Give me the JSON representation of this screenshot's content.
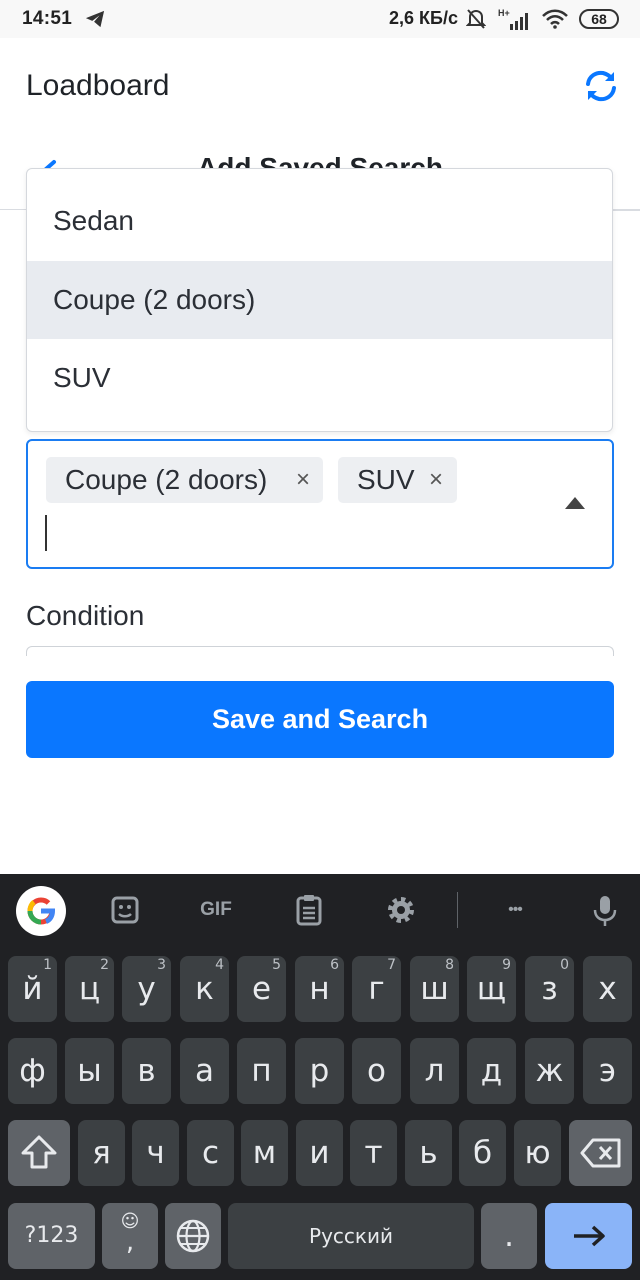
{
  "status_bar": {
    "time": "14:51",
    "network_speed": "2,6 КБ/с",
    "battery": "68",
    "signal_label": "H+"
  },
  "app": {
    "title": "Loadboard",
    "subtitle": "Add Saved Search"
  },
  "dropdown": {
    "options": [
      {
        "label": "Sedan",
        "highlighted": false
      },
      {
        "label": "Coupe (2 doors)",
        "highlighted": true
      },
      {
        "label": "SUV",
        "highlighted": false
      }
    ]
  },
  "multi_select": {
    "selected": [
      "Coupe (2 doors)",
      "SUV"
    ],
    "remove_symbol": "×"
  },
  "condition": {
    "label": "Condition"
  },
  "save_button": {
    "label": "Save and Search"
  },
  "keyboard": {
    "toolbar": {
      "gif_label": "GIF",
      "more_label": "•••"
    },
    "row1": [
      {
        "key": "й",
        "hint": "1"
      },
      {
        "key": "ц",
        "hint": "2"
      },
      {
        "key": "у",
        "hint": "3"
      },
      {
        "key": "к",
        "hint": "4"
      },
      {
        "key": "е",
        "hint": "5"
      },
      {
        "key": "н",
        "hint": "6"
      },
      {
        "key": "г",
        "hint": "7"
      },
      {
        "key": "ш",
        "hint": "8"
      },
      {
        "key": "щ",
        "hint": "9"
      },
      {
        "key": "з",
        "hint": "0"
      },
      {
        "key": "х",
        "hint": ""
      }
    ],
    "row2": [
      "ф",
      "ы",
      "в",
      "а",
      "п",
      "р",
      "о",
      "л",
      "д",
      "ж",
      "э"
    ],
    "row3": [
      "я",
      "ч",
      "с",
      "м",
      "и",
      "т",
      "ь",
      "б",
      "ю"
    ],
    "symbols_label": "?123",
    "comma": ",",
    "emoji": "☺",
    "space_label": "Русский",
    "period": "."
  },
  "colors": {
    "accent": "#0a77ff",
    "focus_border": "#1a7cf2",
    "keyboard_bg": "#202124",
    "key_bg": "#3c4043",
    "enter_key": "#8ab4f8"
  }
}
